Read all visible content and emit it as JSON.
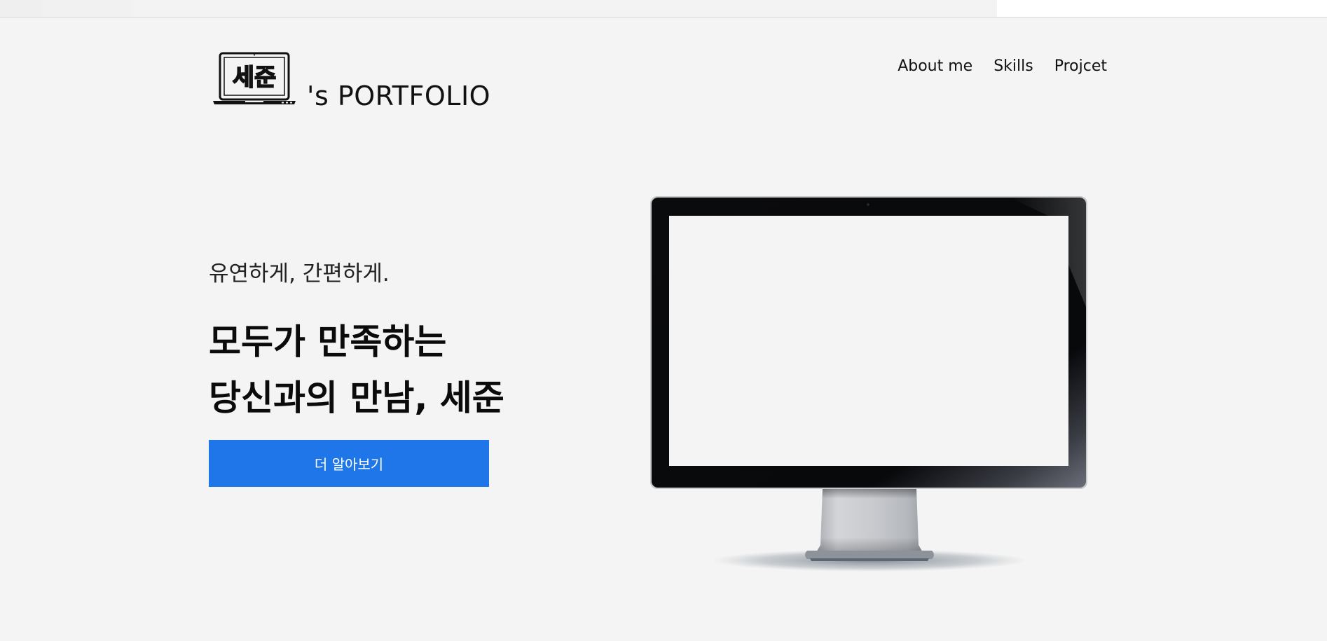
{
  "header": {
    "logo_mark": "세준",
    "brand_suffix": "'s PORTFOLIO"
  },
  "nav": {
    "items": [
      {
        "label": "About me"
      },
      {
        "label": "Skills"
      },
      {
        "label": "Projcet"
      }
    ]
  },
  "hero": {
    "tagline": "유연하게, 간편하게.",
    "headline_line1": "모두가 만족하는",
    "headline_line2": "당신과의 만남, 세준",
    "cta_label": "더 알아보기"
  },
  "colors": {
    "background": "#f4f4f4",
    "accent": "#1e76e8",
    "text": "#111111"
  },
  "icons": {
    "logo": "laptop-icon",
    "hero_image": "desktop-monitor-image"
  }
}
